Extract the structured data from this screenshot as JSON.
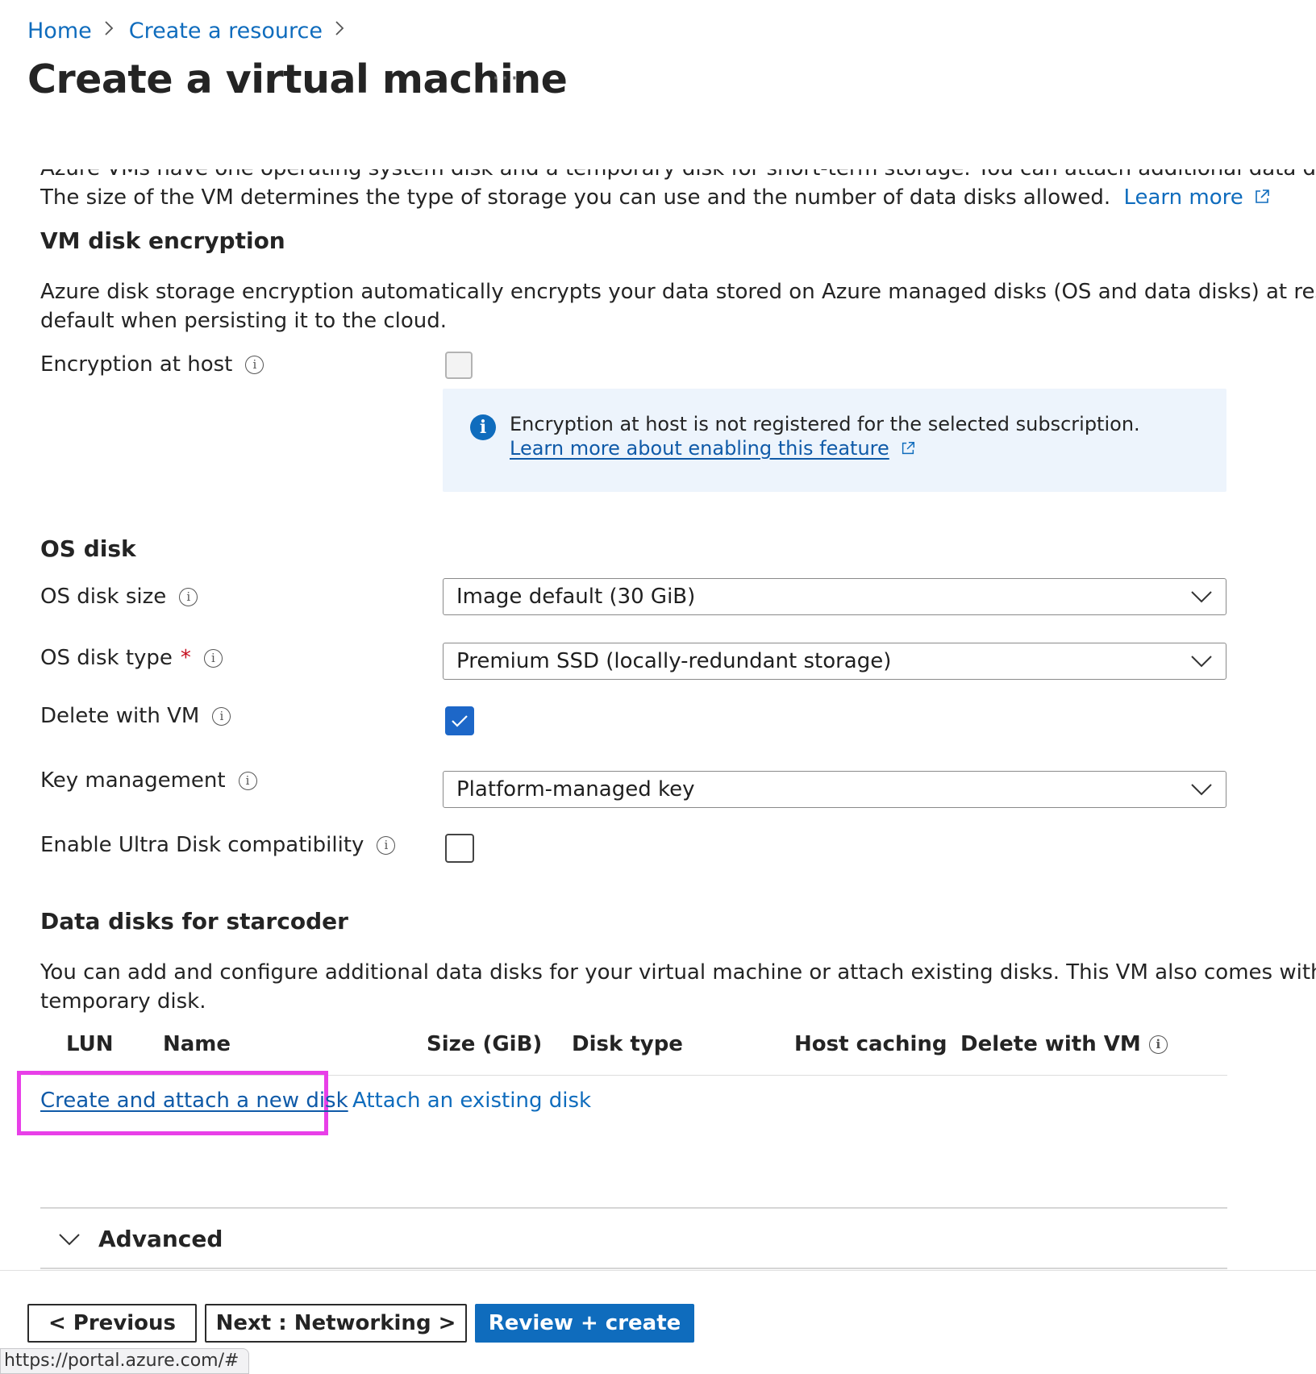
{
  "breadcrumb": {
    "home": "Home",
    "create_resource": "Create a resource"
  },
  "page": {
    "title": "Create a virtual machine",
    "more": "···"
  },
  "intro": {
    "clipped_line": "Azure VMs have one operating system disk and a temporary disk for short-term storage. You can attach additional data disks.",
    "line2": "The size of the VM determines the type of storage you can use and the number of data disks allowed.",
    "learn_more": "Learn more"
  },
  "encryption": {
    "heading": "VM disk encryption",
    "description_line1": "Azure disk storage encryption automatically encrypts your data stored on Azure managed disks (OS and data disks) at rest by",
    "description_line2": "default when persisting it to the cloud.",
    "at_host_label": "Encryption at host",
    "at_host_checked": false,
    "at_host_disabled": true,
    "info_message": "Encryption at host is not registered for the selected subscription.",
    "info_link": "Learn more about enabling this feature"
  },
  "os_disk": {
    "heading": "OS disk",
    "size_label": "OS disk size",
    "size_value": "Image default (30 GiB)",
    "type_label": "OS disk type",
    "required_mark": "*",
    "type_value": "Premium SSD (locally-redundant storage)",
    "delete_label": "Delete with VM",
    "delete_checked": true,
    "key_label": "Key management",
    "key_value": "Platform-managed key",
    "ultra_label": "Enable Ultra Disk compatibility",
    "ultra_checked": false
  },
  "data_disks": {
    "heading": "Data disks for starcoder",
    "description_line1": "You can add and configure additional data disks for your virtual machine or attach existing disks. This VM also comes with a",
    "description_line2": "temporary disk.",
    "columns": [
      "LUN",
      "Name",
      "Size (GiB)",
      "Disk type",
      "Host caching",
      "Delete with VM"
    ],
    "create_link": "Create and attach a new disk",
    "attach_link": "Attach an existing disk"
  },
  "advanced": {
    "label": "Advanced"
  },
  "footer": {
    "previous": "< Previous",
    "next": "Next : Networking >",
    "review": "Review + create",
    "status_url": "https://portal.azure.com/#"
  },
  "colors": {
    "link": "#0f6cbd",
    "primary_button": "#0f6cbd",
    "checkbox_checked": "#1d67c8",
    "info_box_bg": "#edf4fc",
    "highlight": "#e83fe8",
    "required": "#c50f1f"
  },
  "icons": {
    "chevron_right": "chevron-right-icon",
    "external_link": "external-link-icon",
    "info": "info-icon",
    "chevron_down": "chevron-down-icon",
    "checkmark": "checkmark-icon"
  }
}
